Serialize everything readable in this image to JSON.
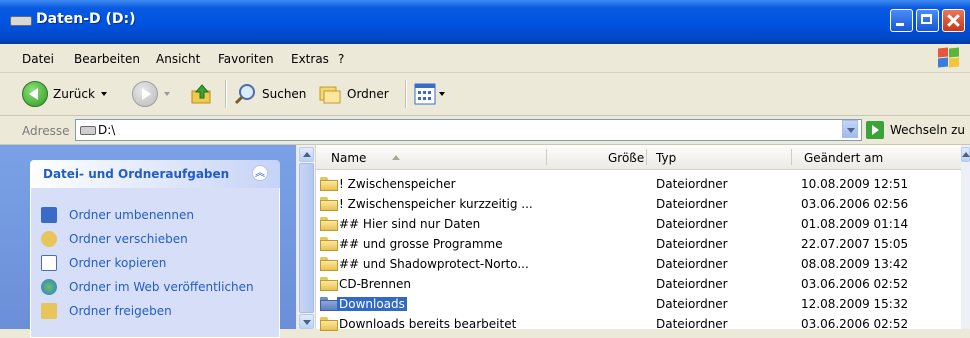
{
  "window": {
    "title": "Daten-D (D:)"
  },
  "menu": [
    "Datei",
    "Bearbeiten",
    "Ansicht",
    "Favoriten",
    "Extras",
    "?"
  ],
  "toolbar": {
    "back": "Zurück",
    "search": "Suchen",
    "folders": "Ordner"
  },
  "address": {
    "label": "Adresse",
    "path": "D:\\",
    "go": "Wechseln zu"
  },
  "tasks": {
    "title": "Datei- und Ordneraufgaben",
    "items": [
      {
        "label": "Ordner umbenennen",
        "icon": "rename-icon",
        "color": "#3a6bc6"
      },
      {
        "label": "Ordner verschieben",
        "icon": "move-icon",
        "color": "#3c9a3a"
      },
      {
        "label": "Ordner kopieren",
        "icon": "copy-icon",
        "color": "#ffffff"
      },
      {
        "label": "Ordner im Web veröffentlichen",
        "icon": "publish-web-icon",
        "color": "#2f9a5a"
      },
      {
        "label": "Ordner freigeben",
        "icon": "share-icon",
        "color": "#e7c55a"
      }
    ]
  },
  "columns": {
    "name": "Name",
    "size": "Größe",
    "type": "Typ",
    "modified": "Geändert am"
  },
  "files": [
    {
      "name": "! Zwischenspeicher",
      "type": "Dateiordner",
      "date": "10.08.2009 12:51",
      "selected": false
    },
    {
      "name": "! Zwischenspeicher kurzzeitig ...",
      "type": "Dateiordner",
      "date": "03.06.2006 02:56",
      "selected": false
    },
    {
      "name": "## Hier sind nur Daten",
      "type": "Dateiordner",
      "date": "01.08.2009 01:14",
      "selected": false
    },
    {
      "name": "## und grosse Programme",
      "type": "Dateiordner",
      "date": "22.07.2007 15:05",
      "selected": false
    },
    {
      "name": "## und Shadowprotect-Norto...",
      "type": "Dateiordner",
      "date": "08.08.2009 13:42",
      "selected": false
    },
    {
      "name": "CD-Brennen",
      "type": "Dateiordner",
      "date": "03.06.2006 02:52",
      "selected": false
    },
    {
      "name": "Downloads",
      "type": "Dateiordner",
      "date": "12.08.2009 15:32",
      "selected": true
    },
    {
      "name": "Downloads bereits bearbeitet",
      "type": "Dateiordner",
      "date": "03.06.2006 02:52",
      "selected": false
    }
  ]
}
